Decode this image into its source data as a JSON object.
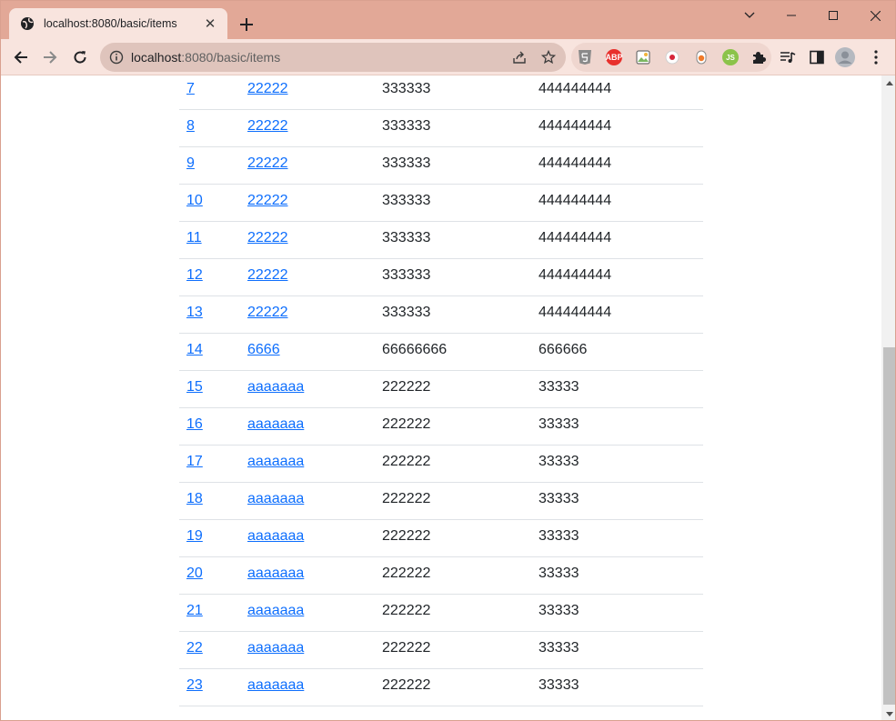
{
  "tab": {
    "title": "localhost:8080/basic/items",
    "favicon": "globe-icon",
    "close": "✕"
  },
  "window_controls": [
    "chevron-down-icon",
    "minimize-icon",
    "maximize-icon",
    "close-icon"
  ],
  "toolbar": {
    "url_host": "localhost",
    "url_rest": ":8080/basic/items",
    "icons": [
      "back-icon",
      "forward-icon",
      "reload-icon",
      "info-icon",
      "share-icon",
      "star-icon"
    ],
    "extensions": [
      "html5-icon",
      "abp-icon",
      "image-ext-icon",
      "record-icon",
      "flask-icon",
      "js-icon",
      "puzzle-icon"
    ],
    "abp_label": "ABP",
    "js_label": "JS"
  },
  "colors": {
    "link": "#0d6efd",
    "text": "#212529",
    "tabstrip": "#e2a897",
    "toolbar": "#f8e4de"
  },
  "rows": [
    {
      "id": "7",
      "name": "22222",
      "price": "333333",
      "quantity": "444444444"
    },
    {
      "id": "8",
      "name": "22222",
      "price": "333333",
      "quantity": "444444444"
    },
    {
      "id": "9",
      "name": "22222",
      "price": "333333",
      "quantity": "444444444"
    },
    {
      "id": "10",
      "name": "22222",
      "price": "333333",
      "quantity": "444444444"
    },
    {
      "id": "11",
      "name": "22222",
      "price": "333333",
      "quantity": "444444444"
    },
    {
      "id": "12",
      "name": "22222",
      "price": "333333",
      "quantity": "444444444"
    },
    {
      "id": "13",
      "name": "22222",
      "price": "333333",
      "quantity": "444444444"
    },
    {
      "id": "14",
      "name": "6666",
      "price": "66666666",
      "quantity": "666666"
    },
    {
      "id": "15",
      "name": "aaaaaaa",
      "price": "222222",
      "quantity": "33333"
    },
    {
      "id": "16",
      "name": "aaaaaaa",
      "price": "222222",
      "quantity": "33333"
    },
    {
      "id": "17",
      "name": "aaaaaaa",
      "price": "222222",
      "quantity": "33333"
    },
    {
      "id": "18",
      "name": "aaaaaaa",
      "price": "222222",
      "quantity": "33333"
    },
    {
      "id": "19",
      "name": "aaaaaaa",
      "price": "222222",
      "quantity": "33333"
    },
    {
      "id": "20",
      "name": "aaaaaaa",
      "price": "222222",
      "quantity": "33333"
    },
    {
      "id": "21",
      "name": "aaaaaaa",
      "price": "222222",
      "quantity": "33333"
    },
    {
      "id": "22",
      "name": "aaaaaaa",
      "price": "222222",
      "quantity": "33333"
    },
    {
      "id": "23",
      "name": "aaaaaaa",
      "price": "222222",
      "quantity": "33333"
    }
  ]
}
